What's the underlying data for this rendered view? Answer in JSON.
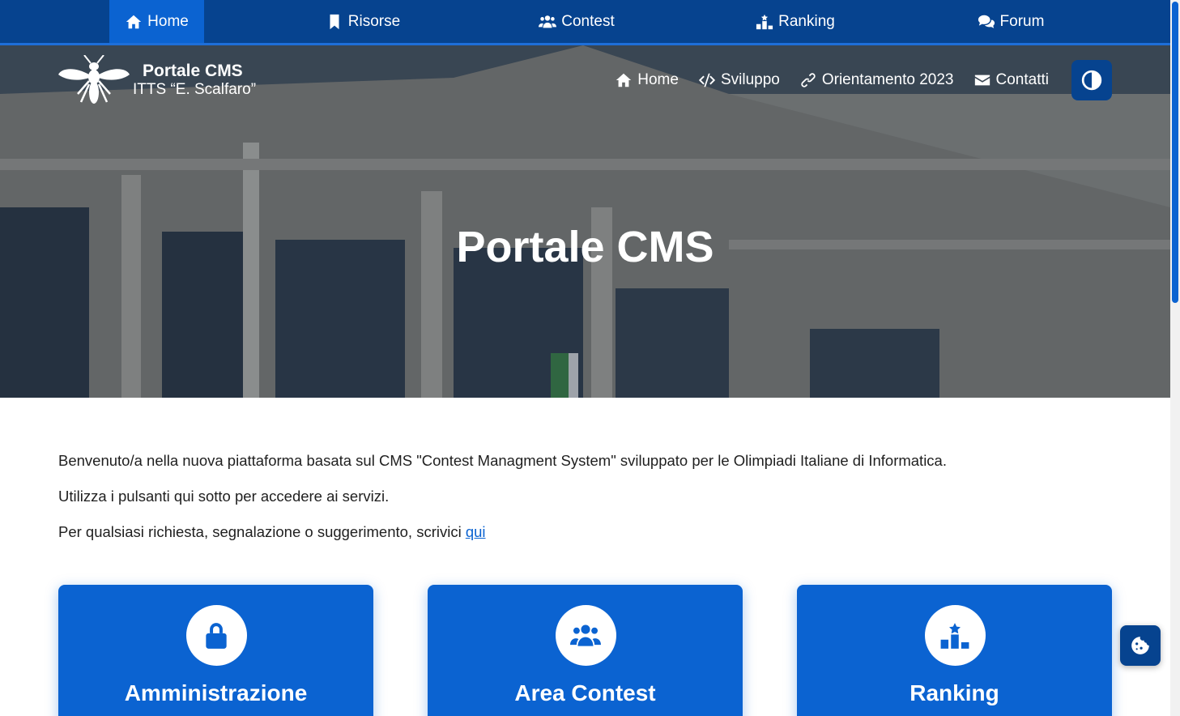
{
  "topnav": {
    "items": [
      {
        "label": "Home",
        "icon": "home-icon",
        "active": true
      },
      {
        "label": "Risorse",
        "icon": "bookmark-icon"
      },
      {
        "label": "Contest",
        "icon": "users-icon"
      },
      {
        "label": "Ranking",
        "icon": "ranking-icon"
      },
      {
        "label": "Forum",
        "icon": "comments-icon"
      }
    ]
  },
  "brand": {
    "title": "Portale CMS",
    "subtitle": "ITTS “E. Scalfaro”"
  },
  "header_nav": {
    "items": [
      {
        "label": "Home",
        "icon": "home-icon"
      },
      {
        "label": "Sviluppo",
        "icon": "code-icon"
      },
      {
        "label": "Orientamento 2023",
        "icon": "link-icon"
      },
      {
        "label": "Contatti",
        "icon": "envelope-icon"
      }
    ],
    "contrast_icon": "contrast-icon"
  },
  "hero": {
    "title": "Portale CMS"
  },
  "intro": {
    "p1": "Benvenuto/a nella nuova piattaforma basata sul CMS \"Contest Managment System\" sviluppato per le Olimpiadi Italiane di Informatica.",
    "p2": "Utilizza i pulsanti qui sotto per accedere ai servizi.",
    "p3": "Per qualsiasi richiesta, segnalazione o suggerimento, scrivici ",
    "p3_link": "qui"
  },
  "cards": [
    {
      "label": "Amministrazione",
      "icon": "lock-icon"
    },
    {
      "label": "Area Contest",
      "icon": "users-icon"
    },
    {
      "label": "Ranking",
      "icon": "ranking-icon"
    }
  ],
  "colors": {
    "primary": "#0b63d1",
    "dark": "#06438f"
  },
  "cookie_icon": "cookie-icon"
}
